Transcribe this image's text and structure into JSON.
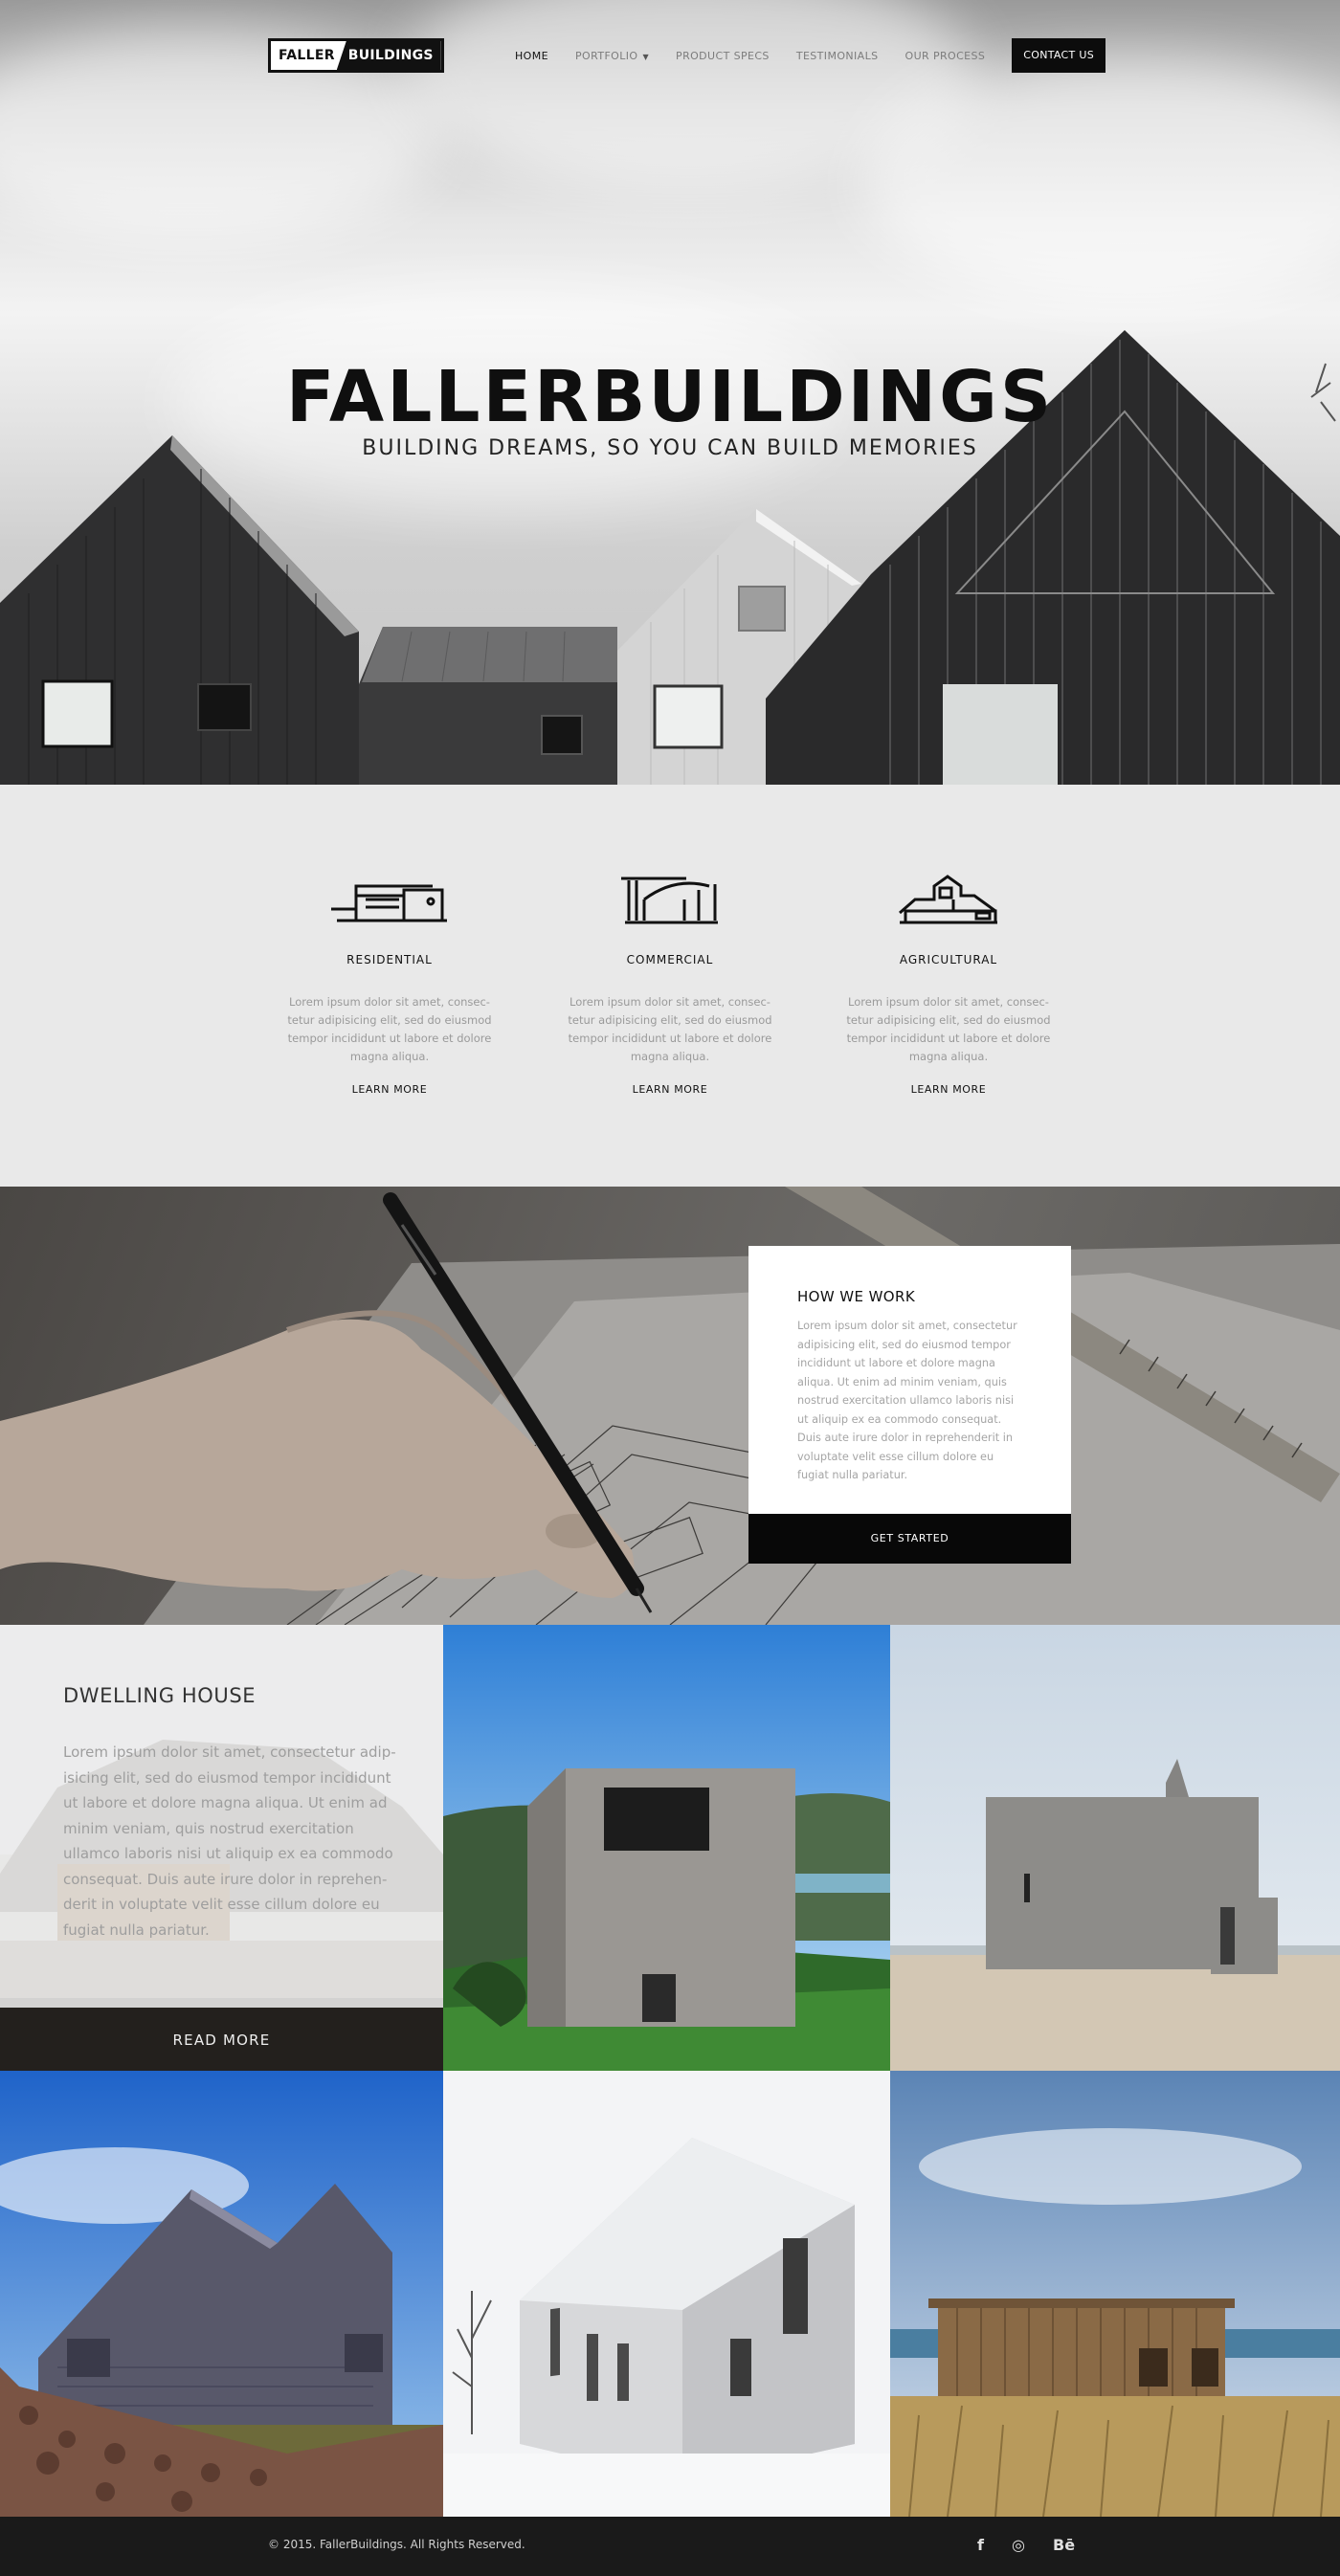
{
  "brand": {
    "part1": "FALLER",
    "part2": "BUILDINGS"
  },
  "nav": {
    "items": [
      {
        "label": "HOME",
        "active": true
      },
      {
        "label": "PORTFOLIO",
        "has_dropdown": true
      },
      {
        "label": "PRODUCT SPECS"
      },
      {
        "label": "TESTIMONIALS"
      },
      {
        "label": "OUR PROCESS"
      }
    ],
    "contact": "CONTACT US"
  },
  "hero": {
    "title": "FALLERBUILDINGS",
    "subtitle": "BUILDING DREAMS, SO YOU CAN BUILD MEMORIES"
  },
  "services": [
    {
      "icon": "residential-house-icon",
      "title": "RESIDENTIAL",
      "text": "Lorem ipsum dolor sit amet, consec-tetur adipisicing elit, sed do eiusmod tempor incididunt ut labore et dolore magna aliqua.",
      "link": "LEARN MORE"
    },
    {
      "icon": "commercial-building-icon",
      "title": "COMMERCIAL",
      "text": "Lorem ipsum dolor sit amet, consec-tetur adipisicing elit, sed do eiusmod tempor incididunt ut labore et dolore magna aliqua.",
      "link": "LEARN MORE"
    },
    {
      "icon": "agricultural-barn-icon",
      "title": "AGRICULTURAL",
      "text": "Lorem ipsum dolor sit amet, consec-tetur adipisicing elit, sed do eiusmod tempor incididunt ut labore et dolore magna aliqua.",
      "link": "LEARN MORE"
    }
  ],
  "how_we_work": {
    "title": "HOW WE WORK",
    "text": "Lorem ipsum dolor sit amet, consectetur adipisicing elit, sed do eiusmod tempor incididunt ut labore et dolore magna aliqua. Ut enim ad minim veniam, quis nostrud exercitation ullamco laboris nisi ut aliquip ex ea commodo consequat. Duis aute irure dolor in reprehenderit in voluptate velit esse cillum dolore eu fugiat nulla pariatur.",
    "button": "GET STARTED"
  },
  "gallery": {
    "feature_title": "DWELLING HOUSE",
    "feature_text": "Lorem ipsum dolor sit amet, consectetur adip-isicing elit, sed do eiusmod tempor incididunt ut labore et dolore magna aliqua. Ut enim ad minim veniam, quis nostrud exercitation ullamco laboris nisi ut aliquip ex ea commodo consequat. Duis aute irure dolor in reprehen-derit in voluptate velit esse cillum dolore eu fugiat nulla pariatur.",
    "read_more": "READ MORE"
  },
  "footer": {
    "copyright": "© 2015. FallerBuildings. All Rights Reserved.",
    "social": [
      {
        "icon": "facebook-icon",
        "glyph": "f"
      },
      {
        "icon": "dribbble-icon",
        "glyph": "◎"
      },
      {
        "icon": "behance-icon",
        "glyph": "Bē"
      }
    ]
  },
  "colors": {
    "dark": "#0c0c0c",
    "light_bg": "#e9e9e9",
    "muted_text": "#9a9a9a"
  }
}
